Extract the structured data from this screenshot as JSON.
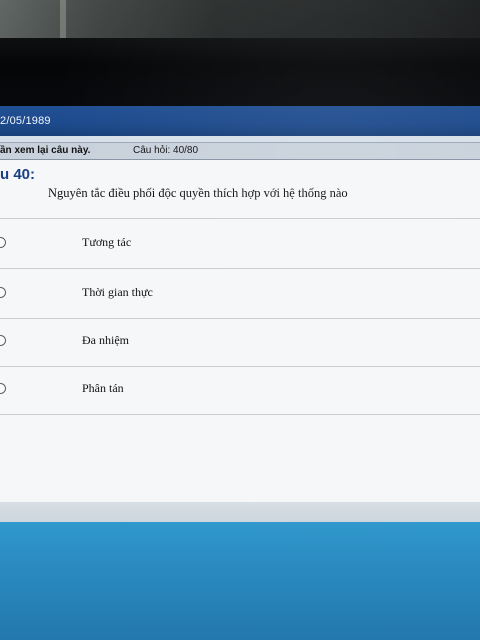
{
  "window": {
    "date": "2/05/1989"
  },
  "status_bar": {
    "review_label": "ần xem lại câu này.",
    "question_counter": "Câu hỏi: 40/80"
  },
  "question": {
    "number_label": "u 40:",
    "text": "Nguyên tắc điều phối độc quyền thích hợp với  hệ thống nào",
    "answers": [
      {
        "label": "Tương tác"
      },
      {
        "label": "Thời gian thực"
      },
      {
        "label": "Đa nhiệm"
      },
      {
        "label": "Phân tán"
      }
    ]
  },
  "colors": {
    "title_bar": "#1d4a8c",
    "question_number": "#1a3f86",
    "taskbar": "#2a8ac0"
  }
}
